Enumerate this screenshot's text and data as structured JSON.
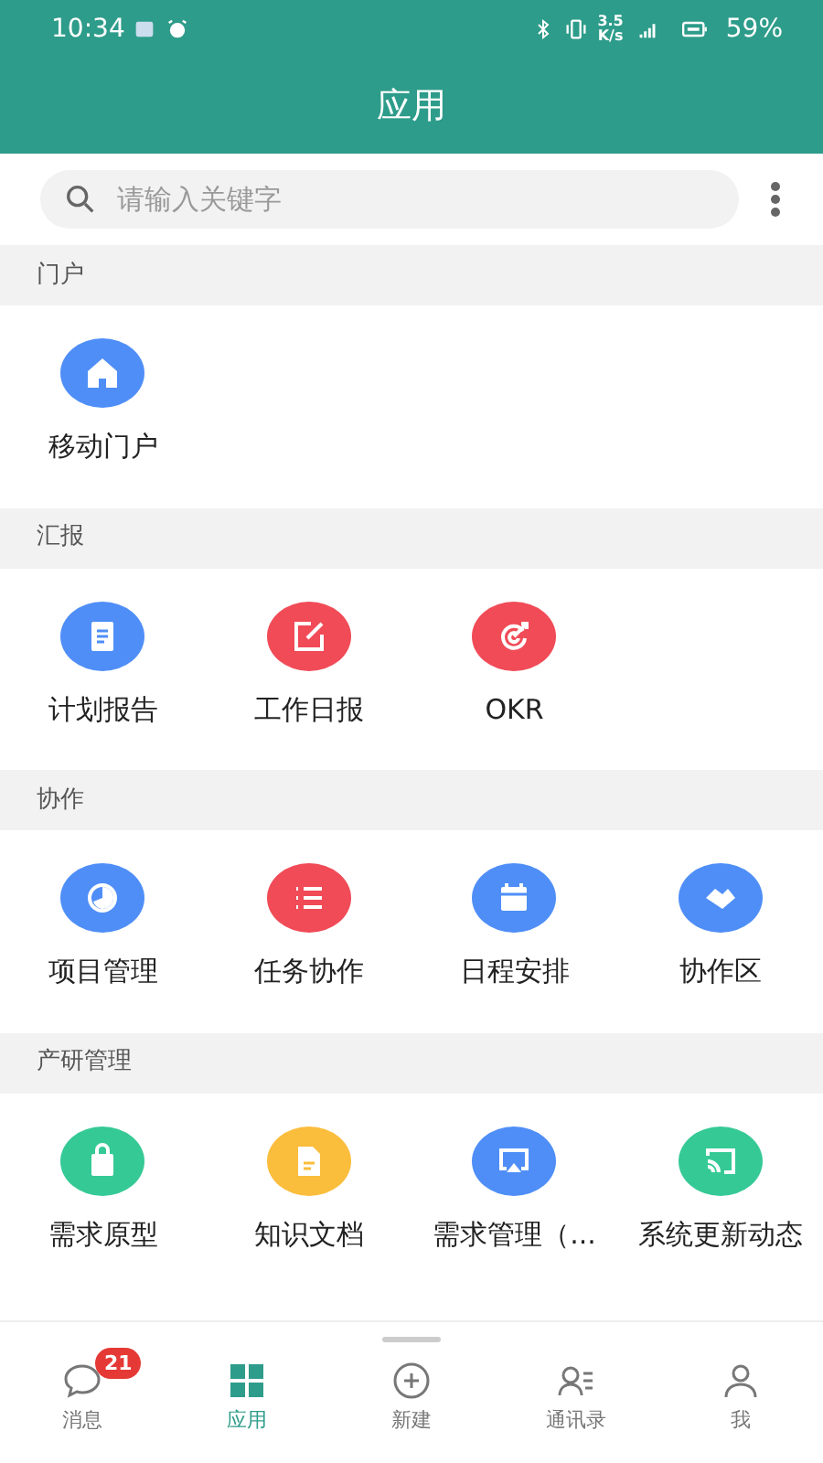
{
  "status_bar": {
    "time": "10:34",
    "speed": "3.5",
    "speed_unit": "K/s",
    "battery": "59%"
  },
  "title": "应用",
  "search": {
    "placeholder": "请输入关键字"
  },
  "sections": [
    {
      "title": "门户",
      "items": [
        {
          "label": "移动门户",
          "color": "#4f8ef7"
        }
      ]
    },
    {
      "title": "汇报",
      "items": [
        {
          "label": "计划报告",
          "color": "#4f8ef7"
        },
        {
          "label": "工作日报",
          "color": "#f04b57"
        },
        {
          "label": "OKR",
          "color": "#f04b57"
        }
      ]
    },
    {
      "title": "协作",
      "items": [
        {
          "label": "项目管理",
          "color": "#4f8ef7"
        },
        {
          "label": "任务协作",
          "color": "#f04b57"
        },
        {
          "label": "日程安排",
          "color": "#4f8ef7"
        },
        {
          "label": "协作区",
          "color": "#4f8ef7"
        }
      ]
    },
    {
      "title": "产研管理",
      "items": [
        {
          "label": "需求原型",
          "color": "#35c996"
        },
        {
          "label": "知识文档",
          "color": "#fbbd3c"
        },
        {
          "label": "需求管理（...",
          "color": "#4f8ef7"
        },
        {
          "label": "系统更新动态",
          "color": "#35c996"
        }
      ]
    }
  ],
  "tabs": [
    {
      "label": "消息",
      "selected": false,
      "badge": "21"
    },
    {
      "label": "应用",
      "selected": true
    },
    {
      "label": "新建",
      "selected": false
    },
    {
      "label": "通讯录",
      "selected": false
    },
    {
      "label": "我",
      "selected": false
    }
  ]
}
